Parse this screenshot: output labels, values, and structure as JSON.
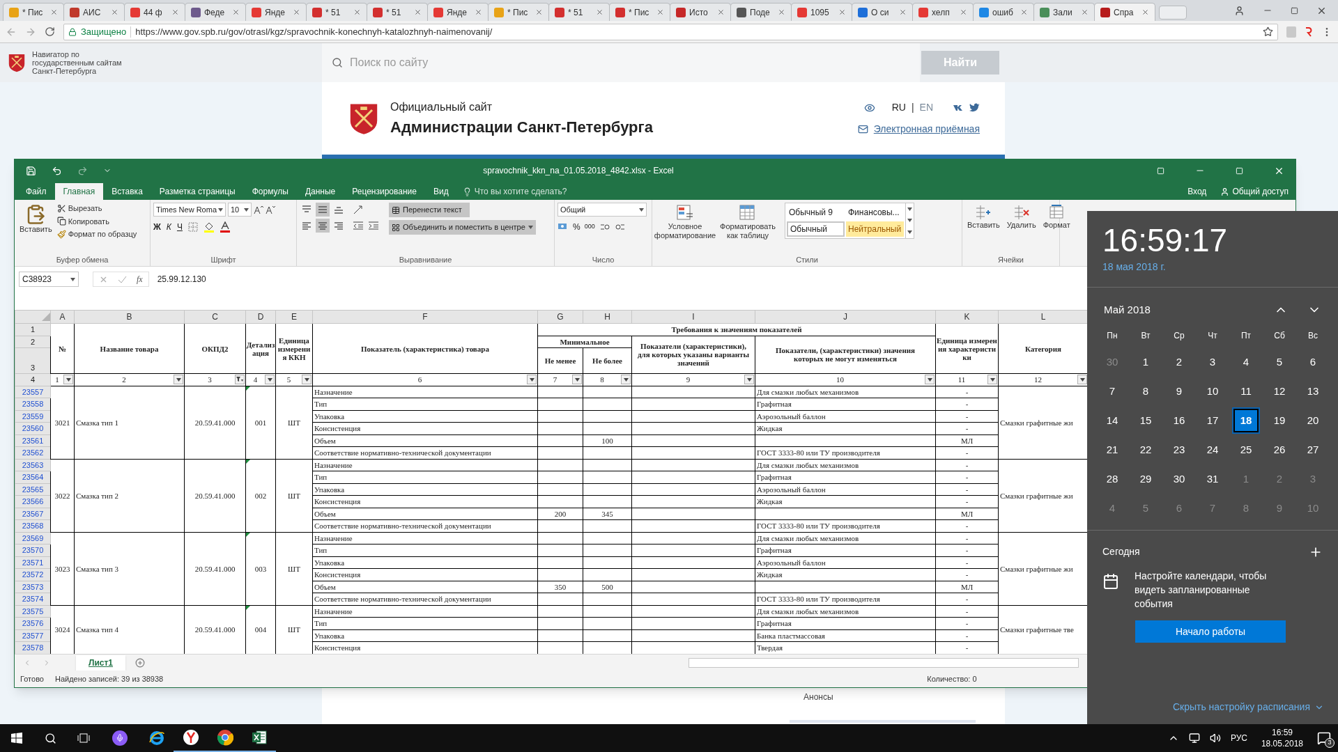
{
  "browser": {
    "tabs": [
      {
        "title": "* Пис",
        "color": "#e8a317",
        "selected": false
      },
      {
        "title": "АИС",
        "color": "#c0392b",
        "selected": false
      },
      {
        "title": "44 ф",
        "color": "#e53935",
        "selected": false
      },
      {
        "title": "Феде",
        "color": "#6d5a8c",
        "selected": false
      },
      {
        "title": "Янде",
        "color": "#e53935",
        "selected": false
      },
      {
        "title": "* 51",
        "color": "#d32f2f",
        "selected": false
      },
      {
        "title": "* 51",
        "color": "#d32f2f",
        "selected": false
      },
      {
        "title": "Янде",
        "color": "#e53935",
        "selected": false
      },
      {
        "title": "* Пис",
        "color": "#e8a317",
        "selected": false
      },
      {
        "title": "* 51",
        "color": "#d32f2f",
        "selected": false
      },
      {
        "title": "* Пис",
        "color": "#d32f2f",
        "selected": false
      },
      {
        "title": "Исто",
        "color": "#c62828",
        "selected": false
      },
      {
        "title": "Поде",
        "color": "#555555",
        "selected": false
      },
      {
        "title": "1095",
        "color": "#e53935",
        "selected": false
      },
      {
        "title": "О си",
        "color": "#1e6fd9",
        "selected": false
      },
      {
        "title": "хелп",
        "color": "#e53935",
        "selected": false
      },
      {
        "title": "ошиб",
        "color": "#1e88e5",
        "selected": false
      },
      {
        "title": "Зали",
        "color": "#4a8f5a",
        "selected": false
      },
      {
        "title": "Спра",
        "color": "#b71c1c",
        "selected": true
      }
    ],
    "security": "Защищено",
    "url": "https://www.gov.spb.ru/gov/otrasl/kgz/spravochnik-konechnyh-katalozhnyh-naimenovanij/"
  },
  "site": {
    "navigator": "Навигатор по государственным сайтам Санкт-Петербурга",
    "search": {
      "placeholder": "Поиск по сайту"
    },
    "search_button": "Найти",
    "subtitle": "Официальный сайт",
    "title": "Администрации Санкт-Петербурга",
    "languages": [
      {
        "label": "RU",
        "selected": true
      },
      {
        "label": "EN",
        "selected": false
      }
    ],
    "separator": "|",
    "reception_link": "Электронная приёмная",
    "announcements": "Анонсы"
  },
  "excel": {
    "title": "spravochnik_kkn_na_01.05.2018_4842.xlsx - Excel",
    "tabs": [
      {
        "label": "Файл",
        "selected": false
      },
      {
        "label": "Главная",
        "selected": true
      },
      {
        "label": "Вставка",
        "selected": false
      },
      {
        "label": "Разметка страницы",
        "selected": false
      },
      {
        "label": "Формулы",
        "selected": false
      },
      {
        "label": "Данные",
        "selected": false
      },
      {
        "label": "Рецензирование",
        "selected": false
      },
      {
        "label": "Вид",
        "selected": false
      }
    ],
    "tell_me": "Что вы хотите сделать?",
    "sign_in": "Вход",
    "share": "Общий доступ",
    "clipboard": {
      "paste": "Вставить",
      "cut": "Вырезать",
      "copy": "Копировать",
      "format_painter": "Формат по образцу",
      "label": "Буфер обмена"
    },
    "font": {
      "name": "Times New Roma",
      "size": "10",
      "bold": "Ж",
      "italic": "К",
      "underline": "Ч",
      "label": "Шрифт"
    },
    "alignment": {
      "buttons": [
        {
          "kind": "top",
          "selected": false
        },
        {
          "kind": "middle",
          "selected": true
        },
        {
          "kind": "bottom",
          "selected": false
        },
        {
          "kind": "left",
          "selected": false
        },
        {
          "kind": "center",
          "selected": true
        },
        {
          "kind": "right",
          "selected": false
        }
      ],
      "wrap_text": {
        "label": "Перенести текст",
        "selected": true
      },
      "merge": {
        "label": "Объединить и поместить в центре",
        "selected": true
      },
      "label": "Выравнивание"
    },
    "number": {
      "format": "Общий",
      "percent": "%",
      "thousands": "000",
      "label": "Число"
    },
    "styles": {
      "conditional": "Условное форматирование",
      "format_table": "Форматировать как таблицу",
      "label": "Стили",
      "gallery": [
        {
          "label": "Обычный 9",
          "kind": "plain"
        },
        {
          "label": "Финансовы...",
          "kind": "plain"
        },
        {
          "label": "Обычный",
          "kind": "current"
        },
        {
          "label": "Нейтральный",
          "kind": "neutral"
        }
      ]
    },
    "cells": {
      "insert": "Вставить",
      "delete": "Удалить",
      "format": "Формат",
      "label": "Ячейки"
    },
    "name_box": "C38923",
    "fx": "fx",
    "formula": "25.99.12.130",
    "columns": [
      "A",
      "B",
      "C",
      "D",
      "E",
      "F",
      "G",
      "H",
      "I",
      "J",
      "K",
      "L"
    ],
    "header_rows": [
      "1",
      "2",
      "3",
      "4"
    ],
    "header": {
      "no": "№",
      "name": "Название товара",
      "okpd": "ОКПД2",
      "detail": "Детализация",
      "unit": "Единица измерения ККН",
      "indicator": "Показатель (характеристика) товара",
      "requirements": "Требования к значениям показателей",
      "minimal": "Минимальное",
      "min": "Не менее",
      "max": "Не более",
      "variants": "Показатели (характеристики), для которых указаны варианты значений",
      "fixed": "Показатели, (характеристики) значения которых не могут изменяться",
      "char_unit": "Единица измерения характеристики",
      "category": "Категория"
    },
    "column_numbers": [
      {
        "label": "1",
        "filtered": false
      },
      {
        "label": "2",
        "filtered": false
      },
      {
        "label": "3",
        "filtered": true
      },
      {
        "label": "4",
        "filtered": false
      },
      {
        "label": "5",
        "filtered": false
      },
      {
        "label": "6",
        "filtered": false
      },
      {
        "label": "7",
        "filtered": false
      },
      {
        "label": "8",
        "filtered": false
      },
      {
        "label": "9",
        "filtered": false
      },
      {
        "label": "10",
        "filtered": false
      },
      {
        "label": "11",
        "filtered": false
      },
      {
        "label": "12",
        "filtered": false
      }
    ],
    "groups": [
      {
        "no": "3021",
        "name": "Смазка тип 1",
        "okpd": "20.59.41.000",
        "detail": "001",
        "unit": "ШТ",
        "category": "Смазки графитные жи",
        "rows": [
          {
            "number": "23557",
            "indicator": "Назначение",
            "fixed": "Для смазки любых механизмов",
            "unit": "-"
          },
          {
            "number": "23558",
            "indicator": "Тип",
            "fixed": "Графитная",
            "unit": "-"
          },
          {
            "number": "23559",
            "indicator": "Упаковка",
            "fixed": "Аэрозольный баллон",
            "unit": "-"
          },
          {
            "number": "23560",
            "indicator": "Консистенция",
            "fixed": "Жидкая",
            "unit": "-"
          },
          {
            "number": "23561",
            "indicator": "Объем",
            "max": "100",
            "unit": "МЛ"
          },
          {
            "number": "23562",
            "indicator": "Соответствие нормативно-технической документации",
            "fixed": "ГОСТ 3333-80 или ТУ производителя",
            "unit": "-"
          }
        ]
      },
      {
        "no": "3022",
        "name": "Смазка тип 2",
        "okpd": "20.59.41.000",
        "detail": "002",
        "unit": "ШТ",
        "category": "Смазки графитные жи",
        "rows": [
          {
            "number": "23563",
            "indicator": "Назначение",
            "fixed": "Для смазки любых механизмов",
            "unit": "-"
          },
          {
            "number": "23564",
            "indicator": "Тип",
            "fixed": "Графитная",
            "unit": "-"
          },
          {
            "number": "23565",
            "indicator": "Упаковка",
            "fixed": "Аэрозольный баллон",
            "unit": "-"
          },
          {
            "number": "23566",
            "indicator": "Консистенция",
            "fixed": "Жидкая",
            "unit": "-"
          },
          {
            "number": "23567",
            "indicator": "Объем",
            "min": "200",
            "max": "345",
            "unit": "МЛ"
          },
          {
            "number": "23568",
            "indicator": "Соответствие нормативно-технической документации",
            "fixed": "ГОСТ 3333-80 или ТУ производителя",
            "unit": "-"
          }
        ]
      },
      {
        "no": "3023",
        "name": "Смазка тип 3",
        "okpd": "20.59.41.000",
        "detail": "003",
        "unit": "ШТ",
        "category": "Смазки графитные жи",
        "rows": [
          {
            "number": "23569",
            "indicator": "Назначение",
            "fixed": "Для смазки любых механизмов",
            "unit": "-"
          },
          {
            "number": "23570",
            "indicator": "Тип",
            "fixed": "Графитная",
            "unit": "-"
          },
          {
            "number": "23571",
            "indicator": "Упаковка",
            "fixed": "Аэрозольный баллон",
            "unit": "-"
          },
          {
            "number": "23572",
            "indicator": "Консистенция",
            "fixed": "Жидкая",
            "unit": "-"
          },
          {
            "number": "23573",
            "indicator": "Объем",
            "min": "350",
            "max": "500",
            "unit": "МЛ"
          },
          {
            "number": "23574",
            "indicator": "Соответствие нормативно-технической документации",
            "fixed": "ГОСТ 3333-80 или ТУ производителя",
            "unit": "-"
          }
        ]
      },
      {
        "no": "3024",
        "name": "Смазка тип 4",
        "okpd": "20.59.41.000",
        "detail": "004",
        "unit": "ШТ",
        "category": "Смазки графитные тве",
        "rows": [
          {
            "number": "23575",
            "indicator": "Назначение",
            "fixed": "Для смазки любых механизмов",
            "unit": "-"
          },
          {
            "number": "23576",
            "indicator": "Тип",
            "fixed": "Графитная",
            "unit": "-"
          },
          {
            "number": "23577",
            "indicator": "Упаковка",
            "fixed": "Банка пластмассовая",
            "unit": "-"
          },
          {
            "number": "23578",
            "indicator": "Консистенция",
            "fixed": "Твердая",
            "unit": "-"
          }
        ]
      }
    ],
    "sheets": [
      {
        "label": "Лист1",
        "selected": true
      }
    ],
    "status": "Готово",
    "found": "Найдено записей: 39 из 38938",
    "count": "Количество: 0"
  },
  "calendar": {
    "time": "16:59:17",
    "date": "18 мая 2018 г.",
    "month": "Май 2018",
    "weekdays": [
      "Пн",
      "Вт",
      "Ср",
      "Чт",
      "Пт",
      "Сб",
      "Вс"
    ],
    "days": [
      {
        "label": "30",
        "in_month": false,
        "selected": false
      },
      {
        "label": "1",
        "in_month": true,
        "selected": false
      },
      {
        "label": "2",
        "in_month": true,
        "selected": false
      },
      {
        "label": "3",
        "in_month": true,
        "selected": false
      },
      {
        "label": "4",
        "in_month": true,
        "selected": false
      },
      {
        "label": "5",
        "in_month": true,
        "selected": false
      },
      {
        "label": "6",
        "in_month": true,
        "selected": false
      },
      {
        "label": "7",
        "in_month": true,
        "selected": false
      },
      {
        "label": "8",
        "in_month": true,
        "selected": false
      },
      {
        "label": "9",
        "in_month": true,
        "selected": false
      },
      {
        "label": "10",
        "in_month": true,
        "selected": false
      },
      {
        "label": "11",
        "in_month": true,
        "selected": false
      },
      {
        "label": "12",
        "in_month": true,
        "selected": false
      },
      {
        "label": "13",
        "in_month": true,
        "selected": false
      },
      {
        "label": "14",
        "in_month": true,
        "selected": false
      },
      {
        "label": "15",
        "in_month": true,
        "selected": false
      },
      {
        "label": "16",
        "in_month": true,
        "selected": false
      },
      {
        "label": "17",
        "in_month": true,
        "selected": false
      },
      {
        "label": "18",
        "in_month": true,
        "selected": true
      },
      {
        "label": "19",
        "in_month": true,
        "selected": false
      },
      {
        "label": "20",
        "in_month": true,
        "selected": false
      },
      {
        "label": "21",
        "in_month": true,
        "selected": false
      },
      {
        "label": "22",
        "in_month": true,
        "selected": false
      },
      {
        "label": "23",
        "in_month": true,
        "selected": false
      },
      {
        "label": "24",
        "in_month": true,
        "selected": false
      },
      {
        "label": "25",
        "in_month": true,
        "selected": false
      },
      {
        "label": "26",
        "in_month": true,
        "selected": false
      },
      {
        "label": "27",
        "in_month": true,
        "selected": false
      },
      {
        "label": "28",
        "in_month": true,
        "selected": false
      },
      {
        "label": "29",
        "in_month": true,
        "selected": false
      },
      {
        "label": "30",
        "in_month": true,
        "selected": false
      },
      {
        "label": "31",
        "in_month": true,
        "selected": false
      },
      {
        "label": "1",
        "in_month": false,
        "selected": false
      },
      {
        "label": "2",
        "in_month": false,
        "selected": false
      },
      {
        "label": "3",
        "in_month": false,
        "selected": false
      },
      {
        "label": "4",
        "in_month": false,
        "selected": false
      },
      {
        "label": "5",
        "in_month": false,
        "selected": false
      },
      {
        "label": "6",
        "in_month": false,
        "selected": false
      },
      {
        "label": "7",
        "in_month": false,
        "selected": false
      },
      {
        "label": "8",
        "in_month": false,
        "selected": false
      },
      {
        "label": "9",
        "in_month": false,
        "selected": false
      },
      {
        "label": "10",
        "in_month": false,
        "selected": false
      }
    ],
    "today": "Сегодня",
    "message": "Настройте календари, чтобы видеть запланированные события",
    "button": "Начало работы",
    "hide_link": "Скрыть настройку расписания"
  },
  "taskbar": {
    "apps": [
      {
        "kind": "ie",
        "running": false
      },
      {
        "kind": "yandex",
        "running": true
      },
      {
        "kind": "chrome",
        "running": true
      },
      {
        "kind": "excel",
        "running": true
      }
    ],
    "language": "РУС",
    "time": "16:59",
    "date": "18.05.2018",
    "notifications": "3"
  }
}
